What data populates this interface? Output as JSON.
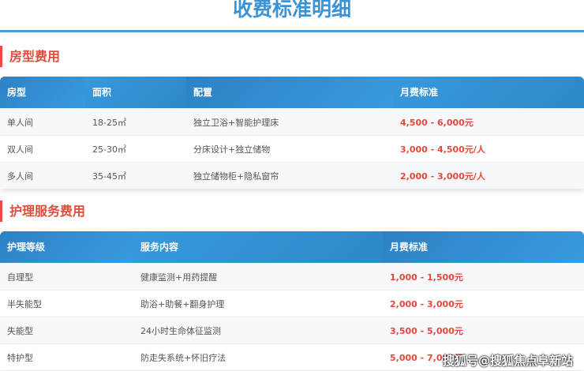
{
  "title": "收费标准明细",
  "room": {
    "heading": "房型费用",
    "columns": [
      "房型",
      "面积",
      "配置",
      "月费标准"
    ],
    "rows": [
      [
        "单人间",
        "18-25㎡",
        "独立卫浴+智能护理床",
        "4,500 - 6,000元"
      ],
      [
        "双人间",
        "25-30㎡",
        "分床设计+独立储物",
        "3,000 - 4,500元/人"
      ],
      [
        "多人间",
        "35-45㎡",
        "独立储物柜+隐私窗帘",
        "2,000 - 3,000元/人"
      ]
    ]
  },
  "care": {
    "heading": "护理服务费用",
    "columns": [
      "护理等级",
      "服务内容",
      "月费标准"
    ],
    "rows": [
      [
        "自理型",
        "健康监测+用药提醒",
        "1,000 - 1,500元"
      ],
      [
        "半失能型",
        "助浴+助餐+翻身护理",
        "2,000 - 3,000元"
      ],
      [
        "失能型",
        "24小时生命体征监测",
        "3,500 - 5,000元"
      ],
      [
        "特护型",
        "防走失系统+怀旧疗法",
        "5,000 - 7,000元"
      ]
    ]
  },
  "watermark": "搜狐号@搜狐焦点阜新站",
  "colors": {
    "accent": "#3b93d6",
    "price": "#e5483a"
  }
}
